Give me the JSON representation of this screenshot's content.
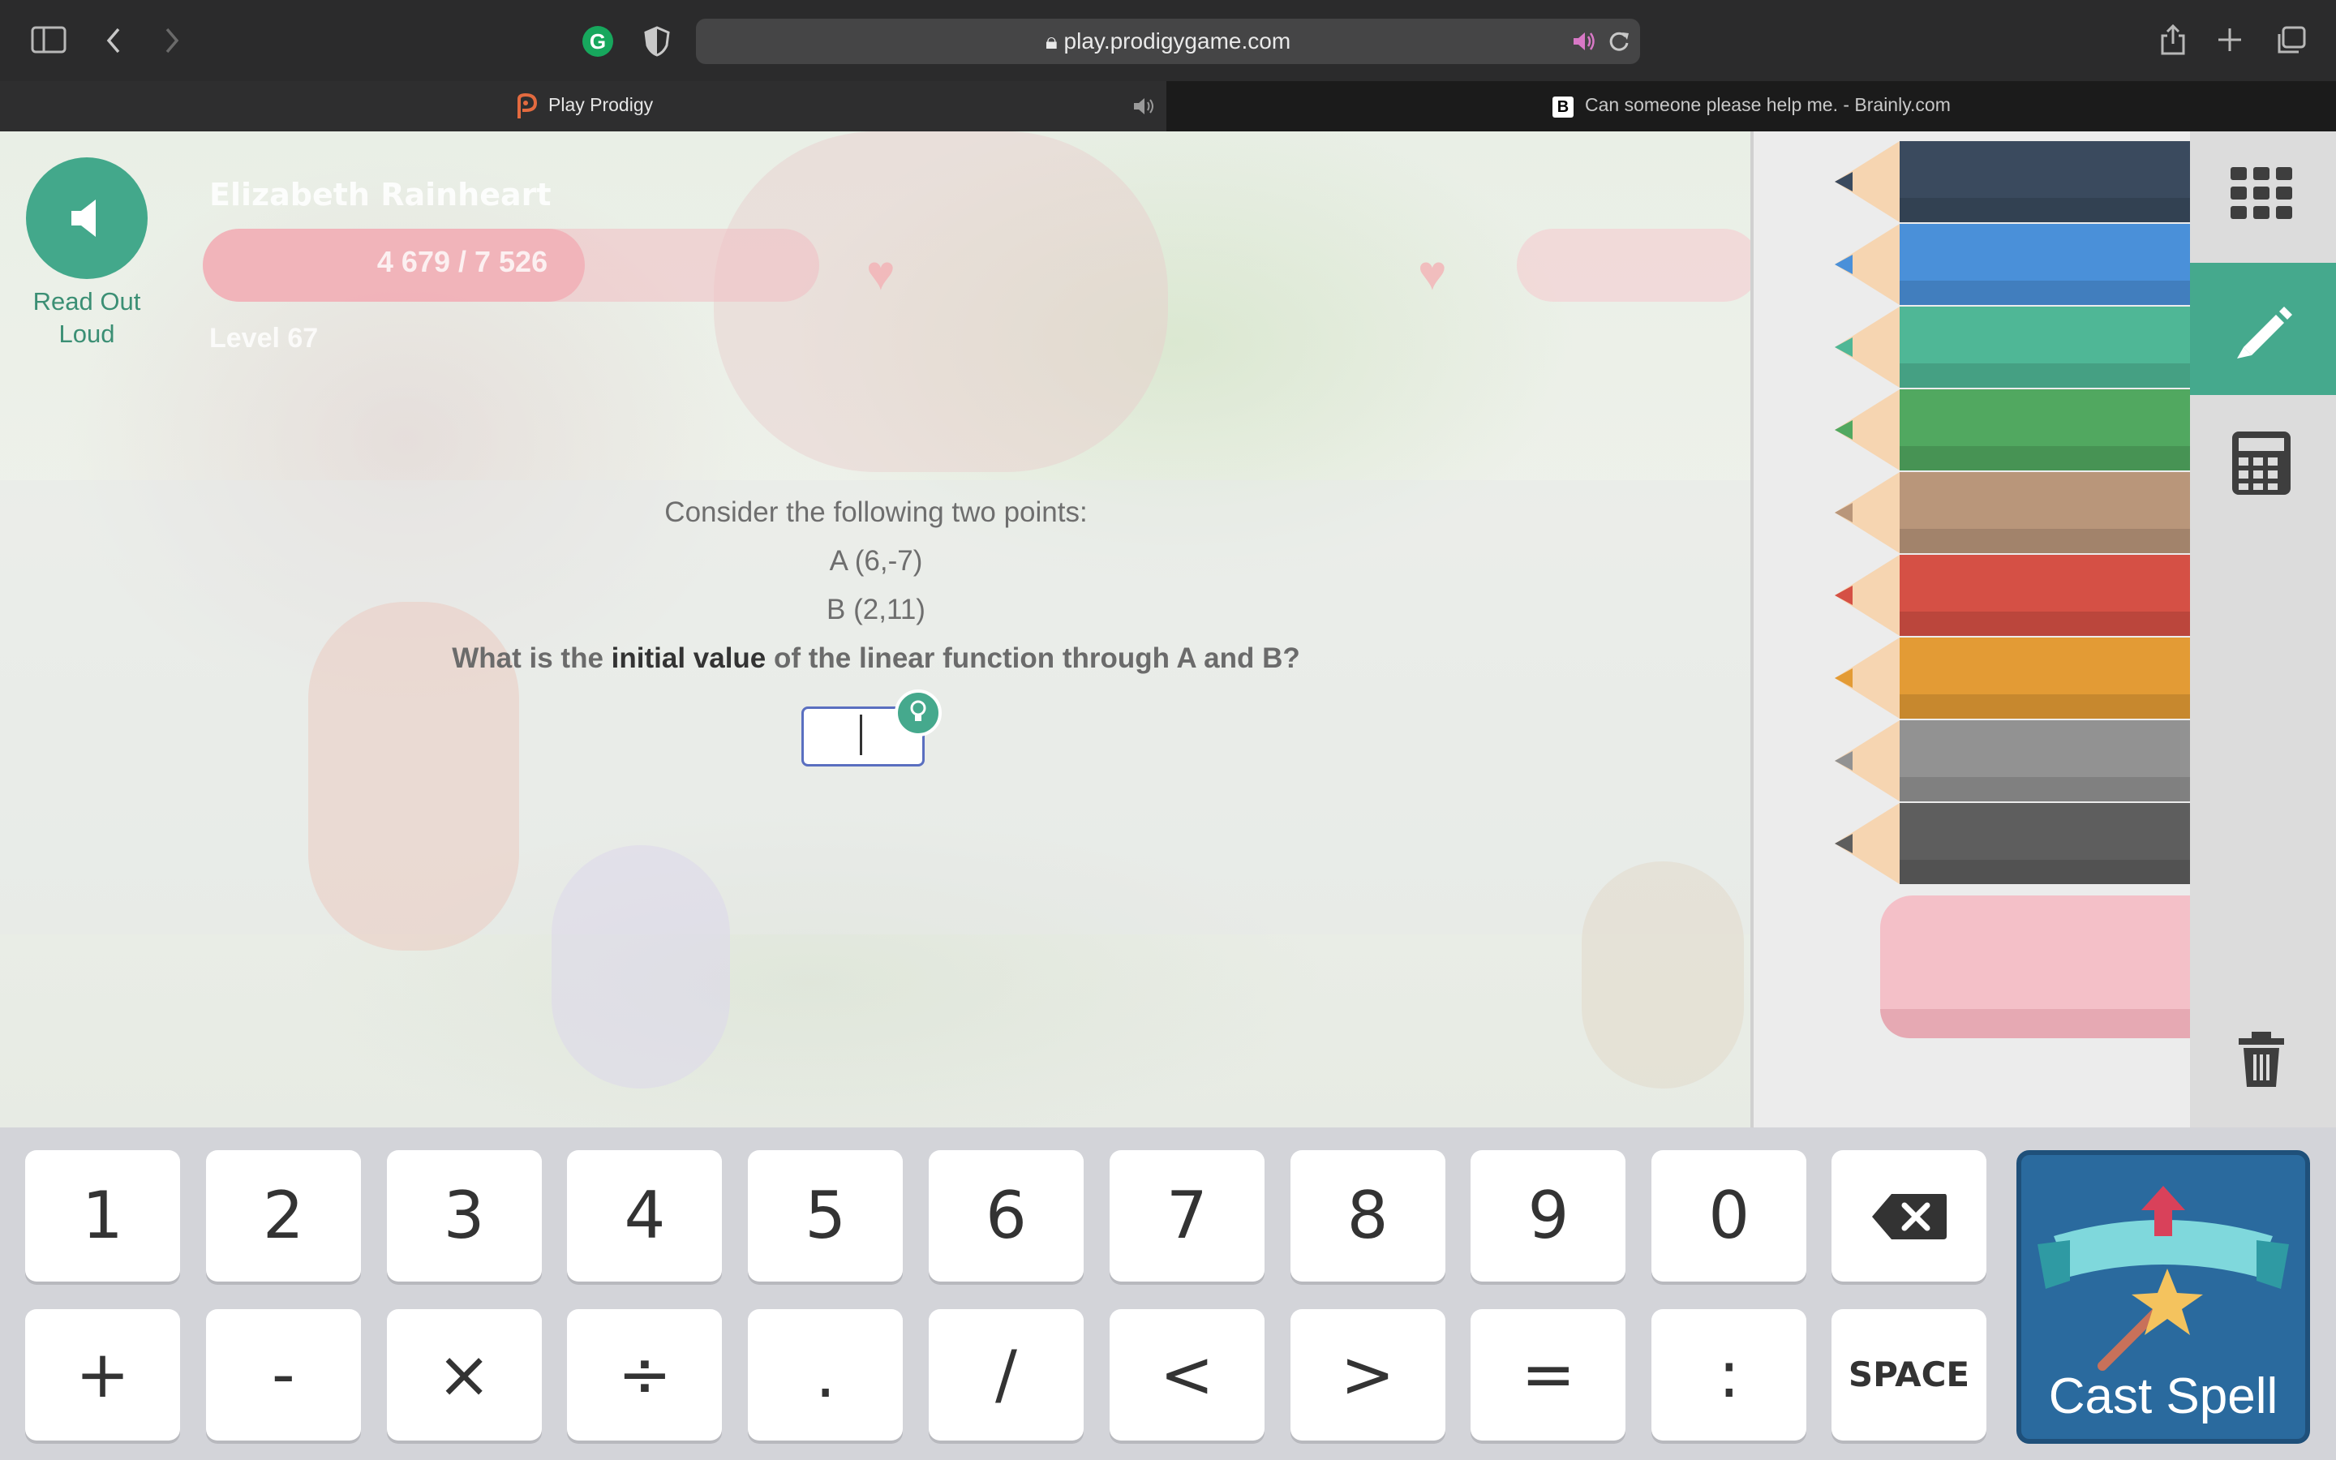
{
  "browser": {
    "url": "play.prodigygame.com",
    "tabs": [
      {
        "title": "Play Prodigy",
        "active": true
      },
      {
        "title": "Can someone please help me. - Brainly.com",
        "active": false
      }
    ]
  },
  "game": {
    "read_aloud_label": "Read Out Loud",
    "player_name": "Elizabeth Rainheart",
    "hp_text": "4 679 / 7 526",
    "hp_fraction": 0.62,
    "level": "Level 67"
  },
  "question": {
    "intro": "Consider the following two points:",
    "point_a": "A (6,-7)",
    "point_b": "B (2,11)",
    "ask_prefix": "What is the ",
    "ask_bold": "initial value",
    "ask_suffix": " of the linear function through A and B?",
    "answer_value": ""
  },
  "drawing_panel": {
    "pencil_colors": [
      "#3a4a5e",
      "#4a90d9",
      "#4fb796",
      "#51a860",
      "#b9967a",
      "#d55045",
      "#e39b35",
      "#929292",
      "#5e5e5e"
    ],
    "tools": [
      "grid-icon",
      "pencil-icon",
      "calculator-icon",
      "trash-icon"
    ],
    "active_tool": "pencil-icon"
  },
  "keypad": {
    "row1": [
      "1",
      "2",
      "3",
      "4",
      "5",
      "6",
      "7",
      "8",
      "9",
      "0"
    ],
    "row2": [
      "+",
      "-",
      "×",
      "÷",
      ".",
      "/",
      "<",
      ">",
      "=",
      ":"
    ],
    "space_label": "SPACE",
    "cast_label": "Cast Spell"
  }
}
